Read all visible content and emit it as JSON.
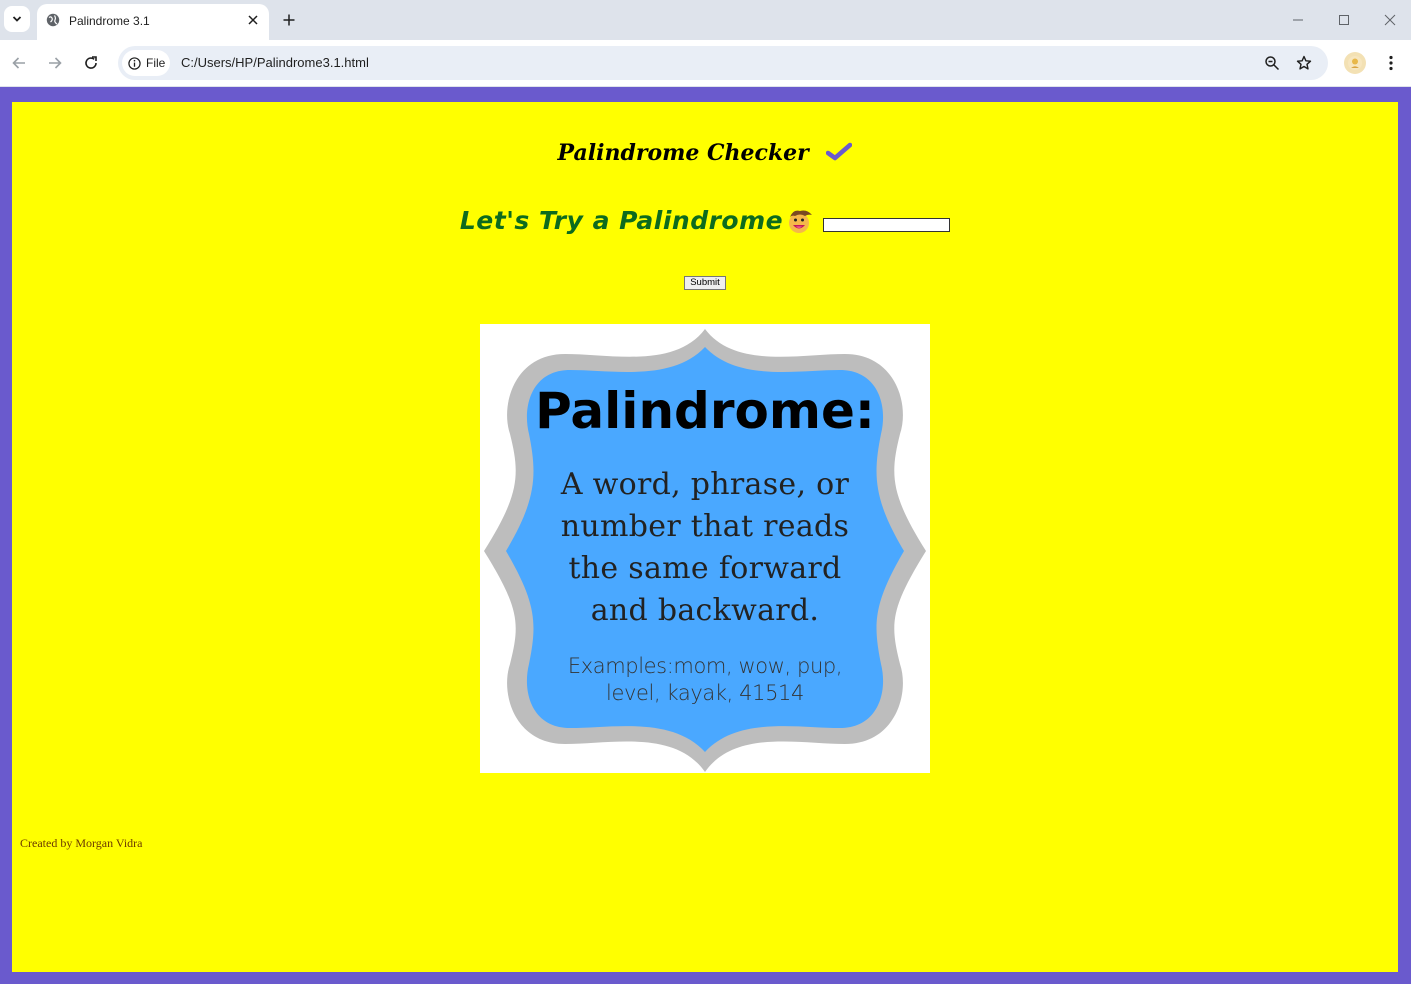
{
  "browser": {
    "tab": {
      "title": "Palindrome 3.1"
    },
    "address_bar": {
      "chip_label": "File",
      "url": "C:/Users/HP/Palindrome3.1.html"
    }
  },
  "page": {
    "heading": "Palindrome Checker",
    "prompt_heading": "Let's Try a Palindrome",
    "input": {
      "value": "",
      "placeholder": ""
    },
    "submit_label": "Submit",
    "definition_image": {
      "title": "Palindrome:",
      "body_lines": [
        "A word, phrase,  or",
        "number that reads",
        "the same forward",
        "and backward."
      ],
      "example_lines": [
        "Examples:mom, wow, pup,",
        "level, kayak, 41514"
      ]
    },
    "footer": "Created by Morgan Vidra"
  },
  "colors": {
    "page_background": "#ffff00",
    "frame_border": "#6a5acd",
    "prompt_heading": "#0d6b1e",
    "checkmark": "#6a5acd",
    "badge_fill": "#4aa8ff",
    "badge_border": "#bdbdbd"
  },
  "icons": [
    "chevron-down-icon",
    "globe-icon",
    "close-icon",
    "plus-icon",
    "minimize-icon",
    "maximize-icon",
    "back-icon",
    "forward-icon",
    "reload-icon",
    "info-icon",
    "zoom-icon",
    "star-icon",
    "avatar",
    "more-icon",
    "checkmark-icon",
    "face-emoji-icon"
  ]
}
